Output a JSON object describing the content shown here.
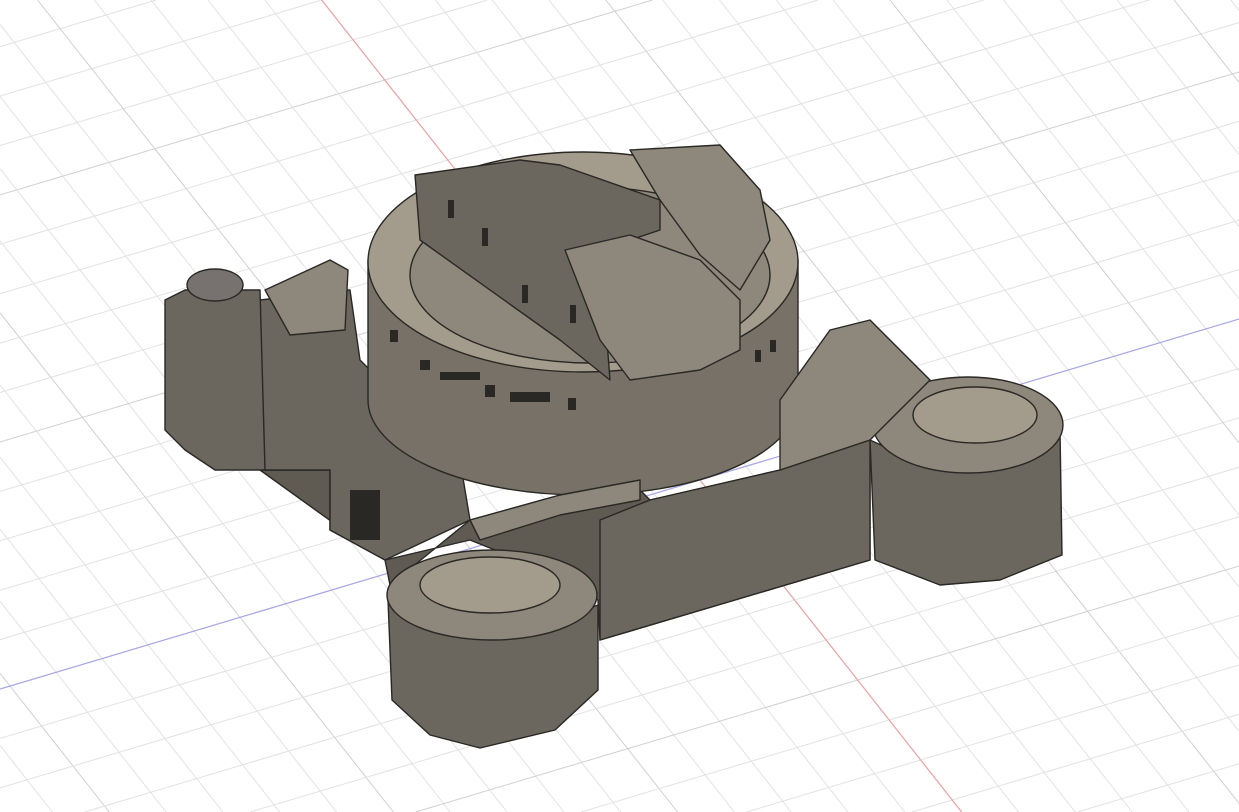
{
  "viewport": {
    "type": "3d-cad-canvas",
    "background": "#ffffff",
    "grid_color": "#e2e2e2",
    "grid_major_color": "#d0d0d0",
    "x_axis_color": "#e9a4a4",
    "y_axis_color": "#a8a8e6",
    "model": {
      "name_icon": "castle-model",
      "body_color": "#6b665e",
      "shadow_color": "#55514a",
      "light_color": "#8d877c",
      "top_color": "#a39b8c",
      "edge_color": "#2a2824"
    }
  }
}
